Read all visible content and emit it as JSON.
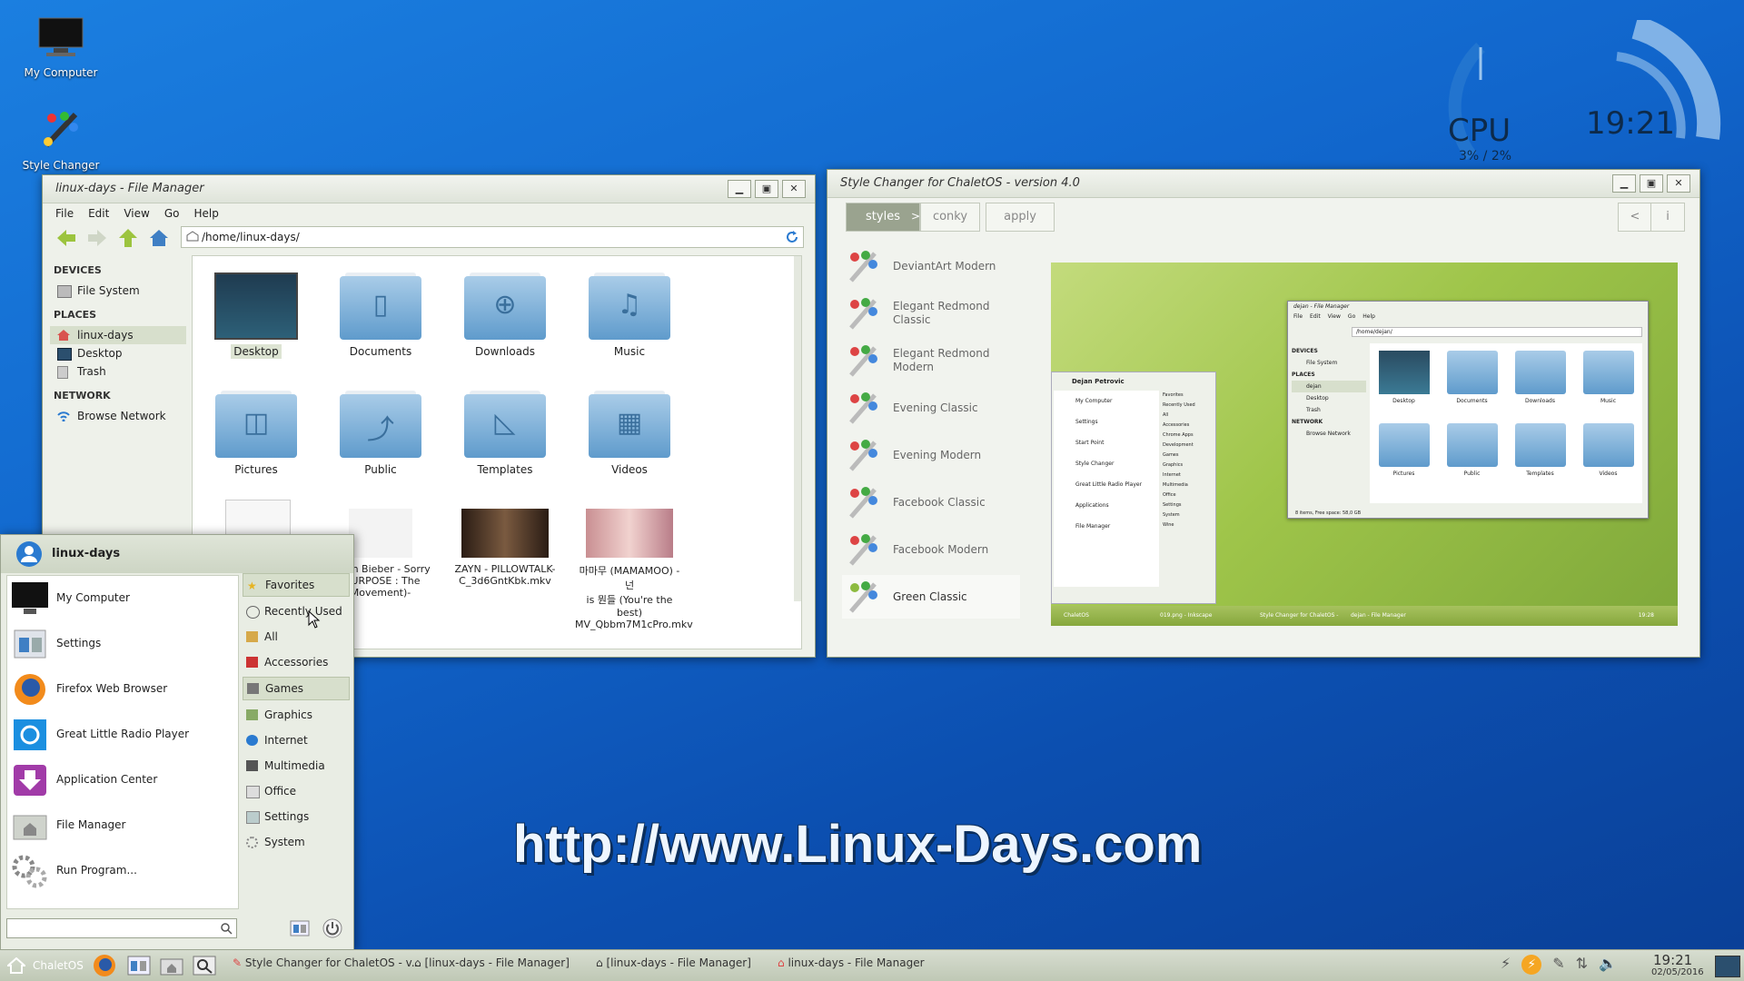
{
  "desktop": {
    "icons": [
      {
        "label": "My Computer"
      },
      {
        "label": "Style Changer"
      }
    ],
    "conky": {
      "cpu_label": "CPU",
      "cpu_value": "3% / 2%",
      "time": "19:21"
    },
    "banner": "http://www.Linux-Days.com"
  },
  "file_manager": {
    "title": "linux-days - File Manager",
    "menu": [
      "File",
      "Edit",
      "View",
      "Go",
      "Help"
    ],
    "path": "/home/linux-days/",
    "sidebar": {
      "devices_header": "DEVICES",
      "devices": [
        "File System"
      ],
      "places_header": "PLACES",
      "places": [
        "linux-days",
        "Desktop",
        "Trash"
      ],
      "network_header": "NETWORK",
      "network": [
        "Browse Network"
      ]
    },
    "items": [
      "Desktop",
      "Documents",
      "Downloads",
      "Music",
      "Pictures",
      "Public",
      "Templates",
      "Videos"
    ],
    "media": [
      {
        "line1": "Justin Bieber - Sorry",
        "line2": "(PURPOSE : The",
        "line3": "Movement)-"
      },
      {
        "line1": "ZAYN - PILLOWTALK-",
        "line2": "C_3d6GntKbk.mkv",
        "line3": ""
      },
      {
        "line1": "마마무 (MAMAMOO) - 넌",
        "line2": "is 뭔들 (You're the best)",
        "line3": "MV_Qbbm7M1cPro.mkv"
      }
    ]
  },
  "start_menu": {
    "user": "linux-days",
    "apps": [
      "My Computer",
      "Settings",
      "Firefox Web Browser",
      "Great Little Radio Player",
      "Application Center",
      "File Manager",
      "Run Program..."
    ],
    "categories": [
      "Favorites",
      "Recently Used",
      "All",
      "Accessories",
      "Games",
      "Graphics",
      "Internet",
      "Multimedia",
      "Office",
      "Settings",
      "System"
    ]
  },
  "style_changer": {
    "title": "Style Changer for ChaletOS - version 4.0",
    "tabs": {
      "styles": "styles",
      "conky": "conky",
      "apply": "apply"
    },
    "nav": {
      "prev": "<",
      "info": "i"
    },
    "styles": [
      "DeviantArt Modern",
      "Elegant Redmond Classic",
      "Elegant Redmond Modern",
      "Evening Classic",
      "Evening Modern",
      "Facebook Classic",
      "Facebook Modern",
      "Green Classic"
    ],
    "preview": {
      "user": "Dejan Petrovic",
      "apps": [
        "My Computer",
        "Settings",
        "Start Point",
        "Style Changer",
        "Great Little Radio Player",
        "Applications",
        "File Manager"
      ],
      "cats": [
        "Favorites",
        "Recently Used",
        "All",
        "Accessories",
        "Chrome Apps",
        "Development",
        "Games",
        "Graphics",
        "Internet",
        "Multimedia",
        "Office",
        "Settings",
        "System",
        "Wine"
      ],
      "fm_title": "dejan - File Manager",
      "fm_menu": [
        "File",
        "Edit",
        "View",
        "Go",
        "Help"
      ],
      "fm_path": "/home/dejan/",
      "fm_side": [
        "DEVICES",
        "File System",
        "PLACES",
        "dejan",
        "Desktop",
        "Trash",
        "NETWORK",
        "Browse Network"
      ],
      "fm_items": [
        "Desktop",
        "Documents",
        "Downloads",
        "Music",
        "Pictures",
        "Public",
        "Templates",
        "Videos"
      ],
      "fm_status": "8 items, Free space: 58,0 GB",
      "taskbar": [
        "ChaletOS",
        "019.png - Inkscape",
        "Style Changer for ChaletOS -",
        "dejan - File Manager"
      ],
      "time": "19:28"
    }
  },
  "taskbar": {
    "start": "ChaletOS",
    "tasks": [
      "Style Changer for ChaletOS - v...",
      "[linux-days - File Manager]",
      "[linux-days - File Manager]",
      "linux-days - File Manager"
    ],
    "clock_time": "19:21",
    "clock_date": "02/05/2016"
  },
  "colors": {
    "accent_green": "#8dbb3f",
    "desktop_blue": "#1166cc",
    "folder_blue": "#5f9bcc"
  }
}
